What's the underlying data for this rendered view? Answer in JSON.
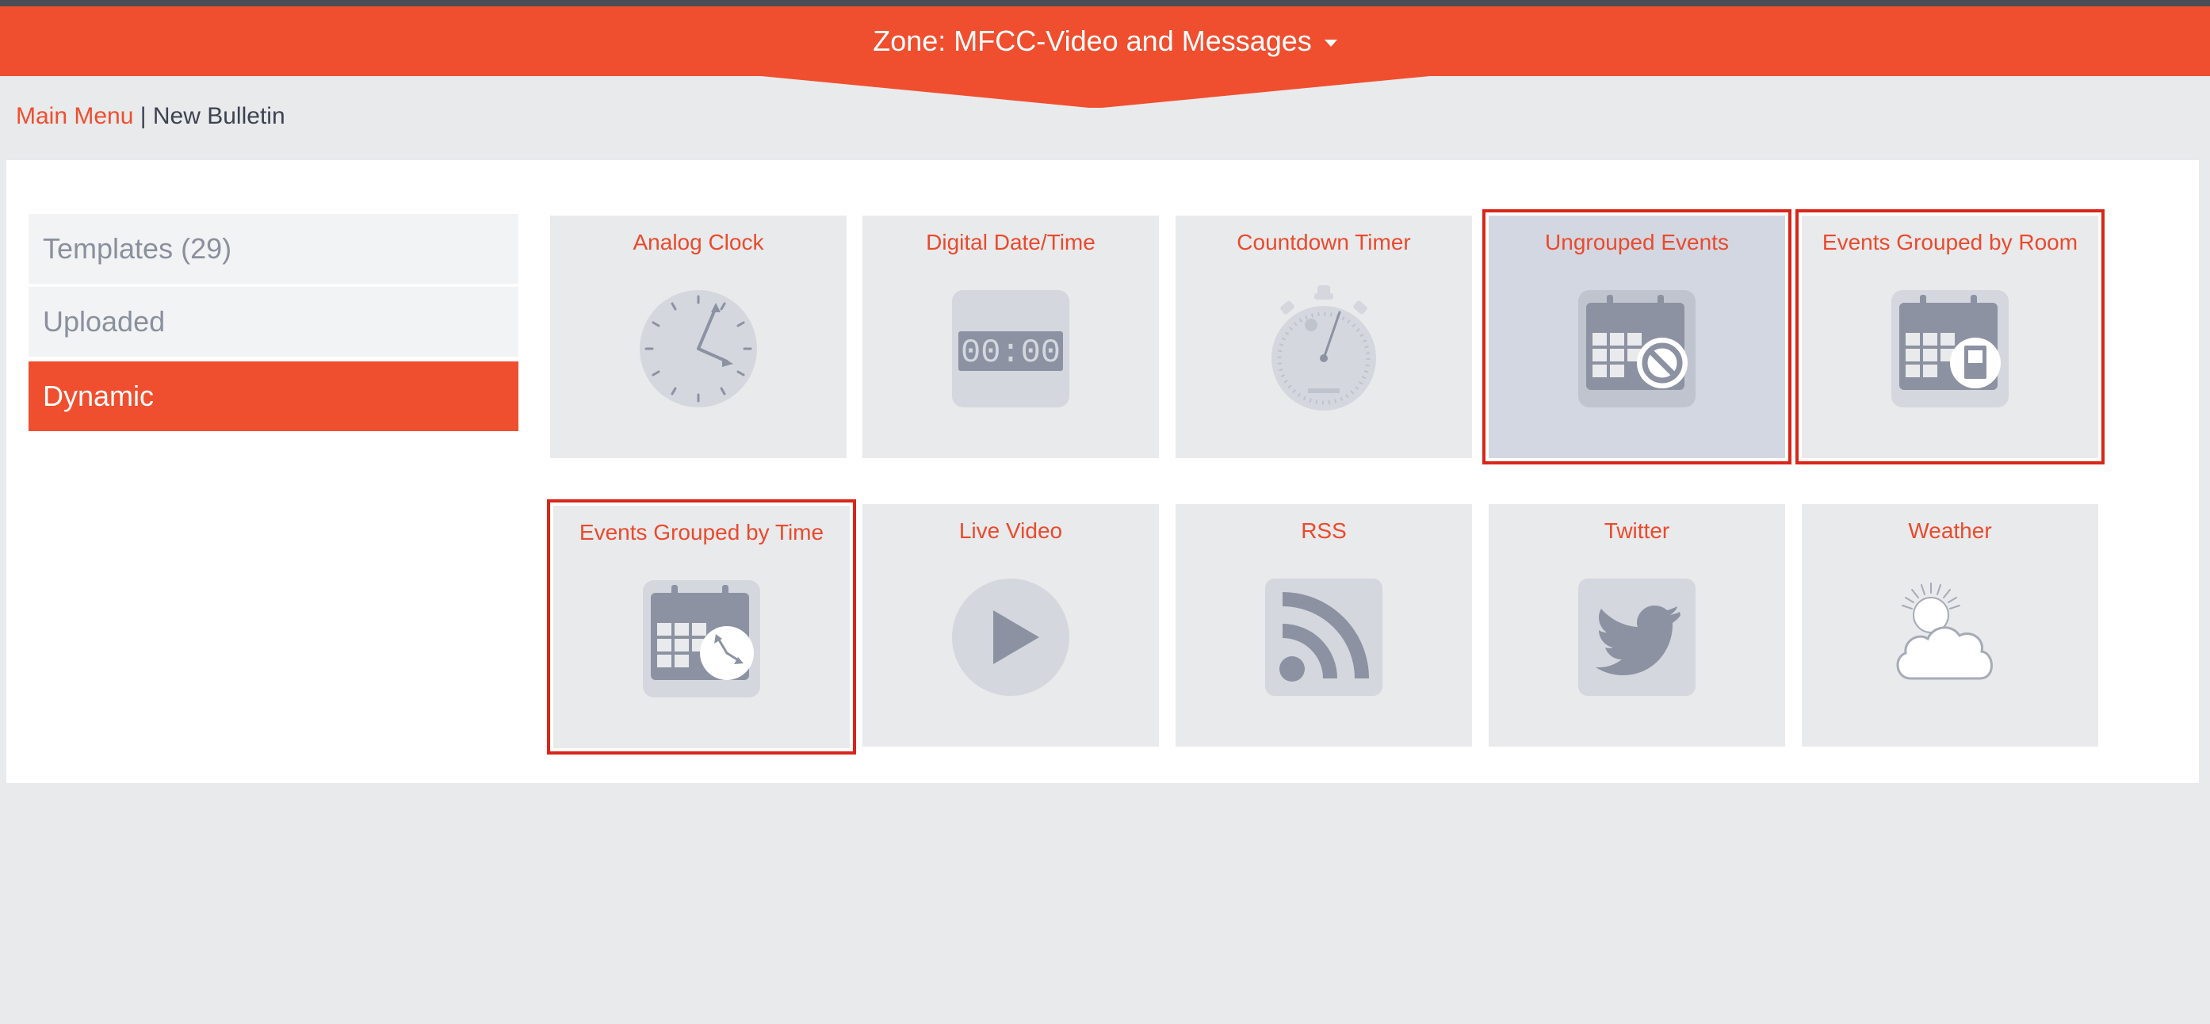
{
  "header": {
    "zone_title": "Zone: MFCC-Video and Messages",
    "accent": "#ef4f2f"
  },
  "breadcrumb": {
    "main_menu": "Main Menu",
    "separator": "|",
    "current": "New Bulletin"
  },
  "sidebar": {
    "items": [
      {
        "label": "Templates (29)",
        "active": false
      },
      {
        "label": "Uploaded",
        "active": false
      },
      {
        "label": "Dynamic",
        "active": true
      }
    ]
  },
  "tiles": [
    {
      "title": "Analog Clock",
      "icon": "analog-clock-icon",
      "highlighted": false,
      "selected": false
    },
    {
      "title": "Digital Date/Time",
      "icon": "digital-clock-icon",
      "highlighted": false,
      "selected": false
    },
    {
      "title": "Countdown Timer",
      "icon": "stopwatch-icon",
      "highlighted": false,
      "selected": false
    },
    {
      "title": "Ungrouped Events",
      "icon": "calendar-prohibited-icon",
      "highlighted": true,
      "selected": true
    },
    {
      "title": "Events Grouped by Room",
      "icon": "calendar-door-icon",
      "highlighted": true,
      "selected": false
    },
    {
      "title": "Events Grouped by Time",
      "icon": "calendar-clock-icon",
      "highlighted": true,
      "selected": false
    },
    {
      "title": "Live Video",
      "icon": "play-icon",
      "highlighted": false,
      "selected": false
    },
    {
      "title": "RSS",
      "icon": "rss-icon",
      "highlighted": false,
      "selected": false
    },
    {
      "title": "Twitter",
      "icon": "twitter-bird-icon",
      "highlighted": false,
      "selected": false
    },
    {
      "title": "Weather",
      "icon": "sun-cloud-icon",
      "highlighted": false,
      "selected": false
    }
  ],
  "digital_display": "00:00",
  "colors": {
    "highlight_border": "#d8261b",
    "tile_bg": "#e9eaec",
    "selected_tile_bg": "#d3d7e1",
    "icon_gray": "#8c92a2"
  }
}
